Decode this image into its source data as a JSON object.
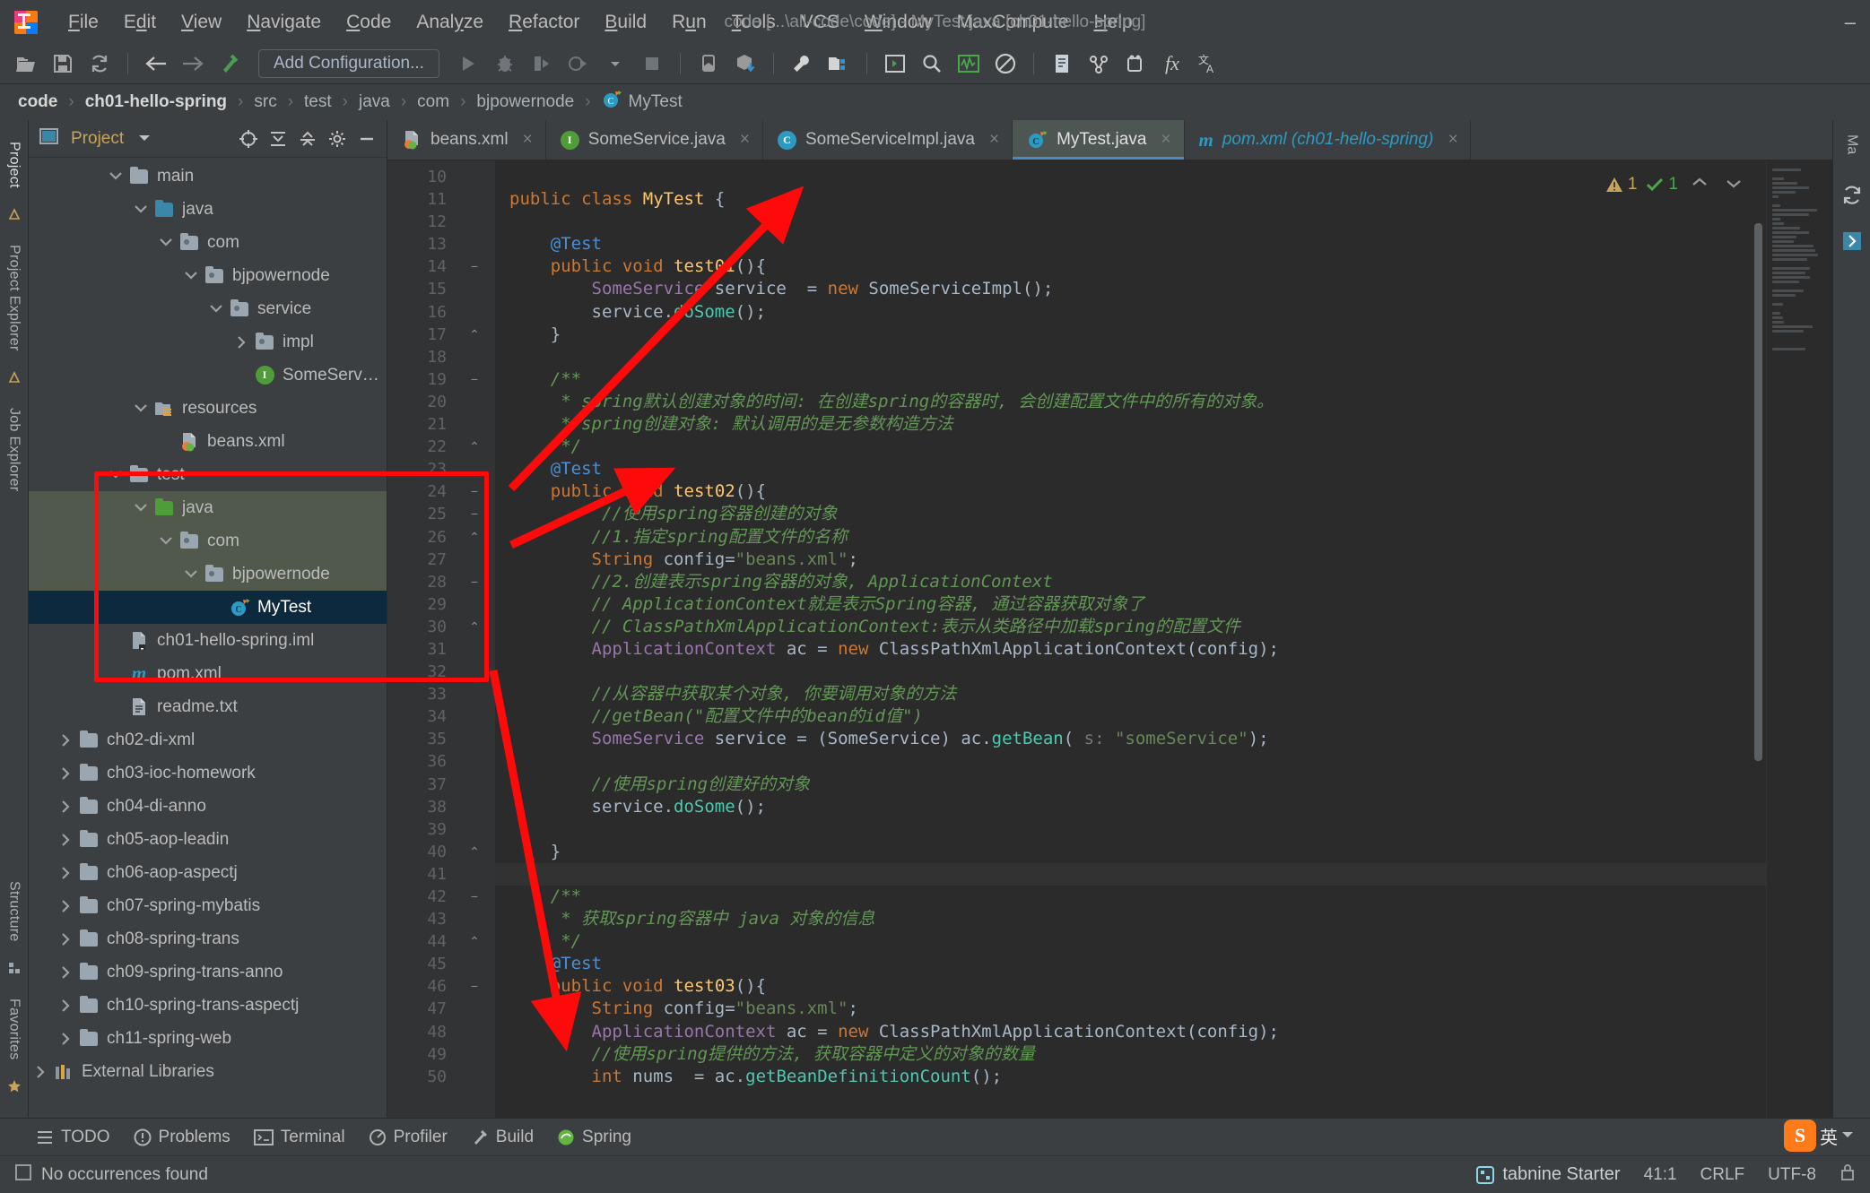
{
  "window": {
    "title": "code [...\\all-code\\code] - MyTest.java [ch01-hello-spring]",
    "minimize": "–"
  },
  "menu": {
    "items": [
      "File",
      "Edit",
      "View",
      "Navigate",
      "Code",
      "Analyze",
      "Refactor",
      "Build",
      "Run",
      "Tools",
      "VCS",
      "Window",
      "MaxCompute",
      "Help"
    ]
  },
  "toolbar": {
    "add_configuration": "Add Configuration...",
    "icons": [
      "open-folder-icon",
      "save-icon",
      "sync-icon",
      "back-arrow-icon",
      "forward-arrow-icon",
      "build-hammer-icon",
      "run-icon",
      "debug-icon",
      "run-coverage-icon",
      "profile-icon",
      "dropdown-icon",
      "stop-icon",
      "device-icon",
      "install-icon",
      "settings-wrench-icon",
      "project-structure-icon",
      "terminal-icon",
      "search-icon",
      "monitor-icon",
      "no-entry-icon",
      "notes-icon",
      "vcs-update-icon",
      "plugins-icon",
      "fx-icon",
      "translate-icon"
    ]
  },
  "breadcrumbs": [
    {
      "label": "code",
      "bold": true
    },
    {
      "label": "ch01-hello-spring",
      "bold": true
    },
    {
      "label": "src",
      "bold": false
    },
    {
      "label": "test",
      "bold": false
    },
    {
      "label": "java",
      "bold": false
    },
    {
      "label": "com",
      "bold": false
    },
    {
      "label": "bjpowernode",
      "bold": false
    },
    {
      "label": "MyTest",
      "bold": false,
      "icon": "java-class-icon"
    }
  ],
  "left_rail": {
    "project_label": "Project",
    "project_explorer_label": "Project Explorer",
    "job_explorer_label": "Job Explorer",
    "structure_label": "Structure",
    "favorites_label": "Favorites"
  },
  "right_rail": {
    "maven_label": "Ma"
  },
  "project_panel": {
    "title": "Project",
    "tools": [
      "locate-icon",
      "expand-all-icon",
      "collapse-all-icon",
      "settings-gear-icon",
      "hide-icon"
    ],
    "tree": [
      {
        "label": "main",
        "indent": 3,
        "twig": "v",
        "icon": "folder-gray",
        "state": "normal"
      },
      {
        "label": "java",
        "indent": 4,
        "twig": "v",
        "icon": "folder-blue",
        "state": "normal"
      },
      {
        "label": "com",
        "indent": 5,
        "twig": "v",
        "icon": "folder-pkg",
        "state": "normal"
      },
      {
        "label": "bjpowernode",
        "indent": 6,
        "twig": "v",
        "icon": "folder-pkg",
        "state": "normal"
      },
      {
        "label": "service",
        "indent": 7,
        "twig": "v",
        "icon": "folder-pkg",
        "state": "normal"
      },
      {
        "label": "impl",
        "indent": 8,
        "twig": ">",
        "icon": "folder-pkg",
        "state": "normal"
      },
      {
        "label": "SomeService",
        "indent": 8,
        "twig": "",
        "icon": "interface-icon",
        "state": "normal"
      },
      {
        "label": "resources",
        "indent": 4,
        "twig": "v",
        "icon": "folder-res",
        "state": "normal"
      },
      {
        "label": "beans.xml",
        "indent": 5,
        "twig": "",
        "icon": "spring-xml-icon",
        "state": "normal"
      },
      {
        "label": "test",
        "indent": 3,
        "twig": "v",
        "icon": "folder-gray",
        "state": "normal"
      },
      {
        "label": "java",
        "indent": 4,
        "twig": "v",
        "icon": "folder-green",
        "state": "green"
      },
      {
        "label": "com",
        "indent": 5,
        "twig": "v",
        "icon": "folder-pkg",
        "state": "green"
      },
      {
        "label": "bjpowernode",
        "indent": 6,
        "twig": "v",
        "icon": "folder-pkg",
        "state": "green"
      },
      {
        "label": "MyTest",
        "indent": 7,
        "twig": "",
        "icon": "java-class-icon",
        "state": "selected"
      },
      {
        "label": "ch01-hello-spring.iml",
        "indent": 3,
        "twig": "",
        "icon": "iml-icon",
        "state": "normal"
      },
      {
        "label": "pom.xml",
        "indent": 3,
        "twig": "",
        "icon": "maven-icon",
        "state": "normal"
      },
      {
        "label": "readme.txt",
        "indent": 3,
        "twig": "",
        "icon": "text-file-icon",
        "state": "normal"
      },
      {
        "label": "ch02-di-xml",
        "indent": 1,
        "twig": ">",
        "icon": "folder-gray",
        "state": "normal"
      },
      {
        "label": "ch03-ioc-homework",
        "indent": 1,
        "twig": ">",
        "icon": "folder-gray",
        "state": "normal"
      },
      {
        "label": "ch04-di-anno",
        "indent": 1,
        "twig": ">",
        "icon": "folder-gray",
        "state": "normal"
      },
      {
        "label": "ch05-aop-leadin",
        "indent": 1,
        "twig": ">",
        "icon": "folder-gray",
        "state": "normal"
      },
      {
        "label": "ch06-aop-aspectj",
        "indent": 1,
        "twig": ">",
        "icon": "folder-gray",
        "state": "normal"
      },
      {
        "label": "ch07-spring-mybatis",
        "indent": 1,
        "twig": ">",
        "icon": "folder-gray",
        "state": "normal"
      },
      {
        "label": "ch08-spring-trans",
        "indent": 1,
        "twig": ">",
        "icon": "folder-gray",
        "state": "normal"
      },
      {
        "label": "ch09-spring-trans-anno",
        "indent": 1,
        "twig": ">",
        "icon": "folder-gray",
        "state": "normal"
      },
      {
        "label": "ch10-spring-trans-aspectj",
        "indent": 1,
        "twig": ">",
        "icon": "folder-gray",
        "state": "normal"
      },
      {
        "label": "ch11-spring-web",
        "indent": 1,
        "twig": ">",
        "icon": "folder-gray",
        "state": "normal"
      },
      {
        "label": "External Libraries",
        "indent": 0,
        "twig": ">",
        "icon": "libraries-icon",
        "state": "normal"
      }
    ]
  },
  "editor": {
    "tabs": [
      {
        "label": "beans.xml",
        "icon": "spring-xml-icon",
        "active": false
      },
      {
        "label": "SomeService.java",
        "icon": "interface-icon",
        "active": false
      },
      {
        "label": "SomeServiceImpl.java",
        "icon": "class-icon",
        "active": false
      },
      {
        "label": "MyTest.java",
        "icon": "java-class-icon",
        "active": true
      },
      {
        "label": "pom.xml (ch01-hello-spring)",
        "icon": "maven-icon",
        "active": false
      }
    ],
    "close_glyph": "×",
    "warning_count": "1",
    "ok_count": "1",
    "first_line_number": 10,
    "lines": [
      {
        "n": 10,
        "html": ""
      },
      {
        "n": 11,
        "html": "<span class='kw'>public</span> <span class='kw'>class</span> <span class='mtd'>MyTest</span> {",
        "run": "»"
      },
      {
        "n": 12,
        "html": ""
      },
      {
        "n": 13,
        "html": "    <span class='anno'>@Test</span>"
      },
      {
        "n": 14,
        "html": "    <span class='kw'>public</span> <span class='kw'>void</span> <span class='mtd'>test01</span>(){",
        "run": "▶",
        "fold": "−"
      },
      {
        "n": 15,
        "html": "        <span class='fld'>SomeService</span> service  = <span class='kw'>new</span> SomeServiceImpl();"
      },
      {
        "n": 16,
        "html": "        service.<span class='cyan'>doSome</span>();"
      },
      {
        "n": 17,
        "html": "    }",
        "fold": "⌃"
      },
      {
        "n": 18,
        "html": ""
      },
      {
        "n": 19,
        "html": "    <span class='cmt'>/**</span>",
        "fold": "−"
      },
      {
        "n": 20,
        "html": "     <span class='cmt'>* spring默认创建对象的时间: 在创建spring的容器时, 会创建配置文件中的所有的对象。</span>"
      },
      {
        "n": 21,
        "html": "     <span class='cmt'>* spring创建对象: 默认调用的是无参数构造方法</span>"
      },
      {
        "n": 22,
        "html": "     <span class='cmt'>*/</span>",
        "fold": "⌃"
      },
      {
        "n": 23,
        "html": "    <span class='anno'>@Test</span>"
      },
      {
        "n": 24,
        "html": "    <span class='kw'>public</span> <span class='kw'>void</span> <span class='mtd'>test02</span>(){",
        "run": "▶",
        "fold": "−"
      },
      {
        "n": 25,
        "html": "         <span class='cmt'>//使用spring容器创建的对象</span>",
        "fold": "−"
      },
      {
        "n": 26,
        "html": "        <span class='cmt'>//1.指定spring配置文件的名称</span>",
        "fold": "⌃"
      },
      {
        "n": 27,
        "html": "        <span class='kw'>String</span> config=<span class='str'>\"beans.xml\"</span>;"
      },
      {
        "n": 28,
        "html": "        <span class='cmt'>//2.创建表示spring容器的对象, ApplicationContext</span>",
        "fold": "−"
      },
      {
        "n": 29,
        "html": "        <span class='cmt'>// ApplicationContext就是表示Spring容器, 通过容器获取对象了</span>"
      },
      {
        "n": 30,
        "html": "        <span class='cmt'>// ClassPathXmlApplicationContext:表示从类路径中加载spring的配置文件</span>",
        "fold": "⌃"
      },
      {
        "n": 31,
        "html": "        <span class='fld'>ApplicationContext</span> ac = <span class='kw'>new</span> ClassPathXmlApplicationContext(config);"
      },
      {
        "n": 32,
        "html": ""
      },
      {
        "n": 33,
        "html": "        <span class='cmt'>//从容器中获取某个对象, 你要调用对象的方法</span>"
      },
      {
        "n": 34,
        "html": "        <span class='cmt'>//getBean(\"配置文件中的bean的id值\")</span>"
      },
      {
        "n": 35,
        "html": "        <span class='fld'>SomeService</span> service = (SomeService) ac.<span class='cyan'>getBean</span>( <span class='hint'>s:</span> <span class='str'>\"someService\"</span>);"
      },
      {
        "n": 36,
        "html": ""
      },
      {
        "n": 37,
        "html": "        <span class='cmt'>//使用spring创建好的对象</span>"
      },
      {
        "n": 38,
        "html": "        service.<span class='cyan'>doSome</span>();"
      },
      {
        "n": 39,
        "html": ""
      },
      {
        "n": 40,
        "html": "    }",
        "fold": "⌃"
      },
      {
        "n": 41,
        "html": "",
        "current": true
      },
      {
        "n": 42,
        "html": "    <span class='cmt'>/**</span>",
        "fold": "−"
      },
      {
        "n": 43,
        "html": "     <span class='cmt'>* 获取spring容器中 java 对象的信息</span>"
      },
      {
        "n": 44,
        "html": "     <span class='cmt'>*/</span>",
        "fold": "⌃"
      },
      {
        "n": 45,
        "html": "    <span class='anno'>@Test</span>"
      },
      {
        "n": 46,
        "html": "    <span class='kw'>public</span> <span class='kw'>void</span> <span class='mtd'>test03</span>(){",
        "run": "▶",
        "fold": "−"
      },
      {
        "n": 47,
        "html": "        <span class='kw'>String</span> config=<span class='str'>\"beans.xml\"</span>;"
      },
      {
        "n": 48,
        "html": "        <span class='fld'>ApplicationContext</span> ac = <span class='kw'>new</span> ClassPathXmlApplicationContext(config);"
      },
      {
        "n": 49,
        "html": "        <span class='cmt'>//使用spring提供的方法, 获取容器中定义的对象的数量</span>"
      },
      {
        "n": 50,
        "html": "        <span class='kw'>int</span> nums  = ac.<span class='cyan'>getBeanDefinitionCount</span>();"
      }
    ]
  },
  "toolwindow_bar": {
    "items": [
      {
        "label": "TODO",
        "icon": "todo-icon"
      },
      {
        "label": "Problems",
        "icon": "problems-icon"
      },
      {
        "label": "Terminal",
        "icon": "terminal-icon"
      },
      {
        "label": "Profiler",
        "icon": "profiler-icon"
      },
      {
        "label": "Build",
        "icon": "build-icon"
      },
      {
        "label": "Spring",
        "icon": "spring-icon"
      }
    ]
  },
  "statusbar": {
    "message": "No occurrences found",
    "tabnine": "tabnine Starter",
    "caret": "41:1",
    "line_separator": "CRLF",
    "encoding": "UTF-8"
  },
  "ime": {
    "label": "英"
  },
  "colors": {
    "accent": "#4a88c7",
    "selection": "#0d293e",
    "green_highlight": "#51584c",
    "annotation_red": "#ff0a0a",
    "warning": "#c8a45a",
    "ok": "#49a949"
  }
}
